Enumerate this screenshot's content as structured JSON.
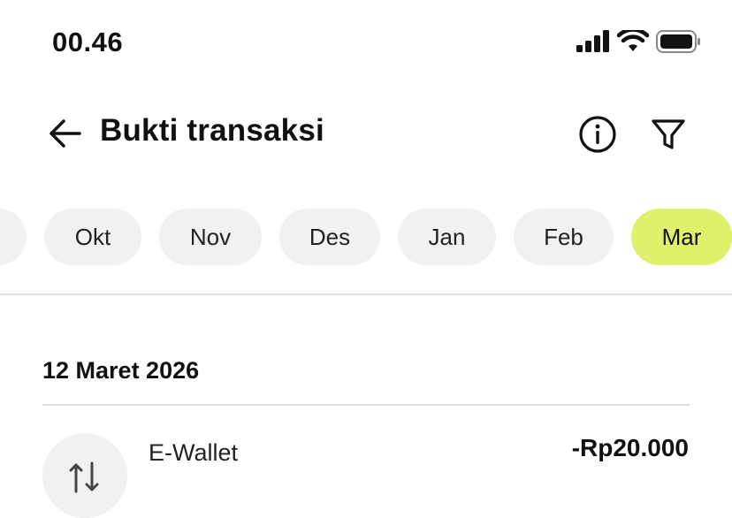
{
  "status_bar": {
    "time": "00.46"
  },
  "header": {
    "title": "Bukti transaksi"
  },
  "months": [
    "",
    "Okt",
    "Nov",
    "Des",
    "Jan",
    "Feb",
    "Mar"
  ],
  "active_month": "Mar",
  "colors": {
    "accent": "#dff06b",
    "chip_bg": "#f1f1f1"
  },
  "transactions": {
    "date": "12 Maret 2026",
    "items": [
      {
        "name": "E-Wallet",
        "amount": "-Rp20.000",
        "icon": "transfer-icon"
      }
    ]
  }
}
